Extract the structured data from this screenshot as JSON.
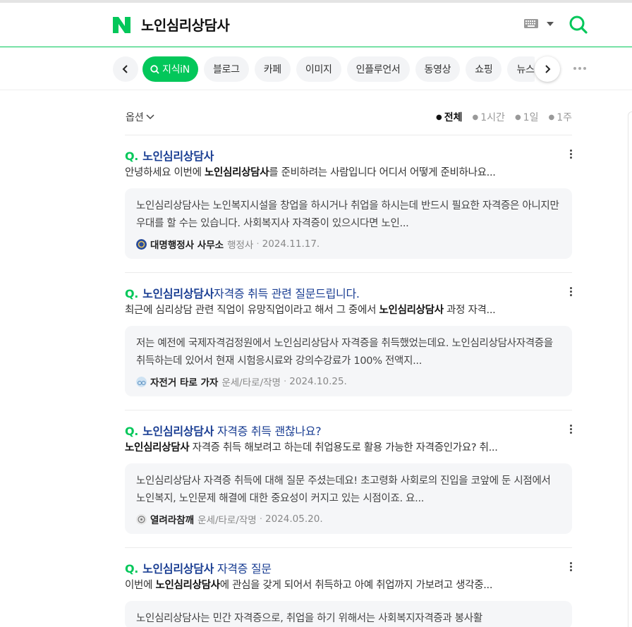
{
  "header": {
    "query": "노인심리상담사"
  },
  "tabs": {
    "items": [
      "지식iN",
      "블로그",
      "카페",
      "이미지",
      "인플루언서",
      "동영상",
      "쇼핑",
      "뉴스"
    ]
  },
  "options": {
    "label": "옵션",
    "periods": [
      "전체",
      "1시간",
      "1일",
      "1주"
    ]
  },
  "results": [
    {
      "title_bold": "노인심리상담사",
      "title_rest": "",
      "desc_pre": "안녕하세요 이번에 ",
      "desc_bold": "노인심리상담사",
      "desc_post": "를 준비하려는 사람입니다 어디서 어떻게 준비하나요...",
      "answer": "노인심리상담사는 노인복지시설을 창업을 하시거나 취업을 하시는데 반드시 필요한 자격증은 아니지만 우대를 할 수는 있습니다. 사회복지사 자격증이 있으시다면 노인...",
      "author": "대명행정사 사무소",
      "category": "행정사",
      "date": "2024.11.17."
    },
    {
      "title_bold": "노인심리상담사",
      "title_rest": "자격증 취득 관련 질문드립니다.",
      "desc_pre": "최근에 심리상담 관련 직업이 유망직업이라고 해서 그 중에서 ",
      "desc_bold": "노인심리상담사",
      "desc_post": " 과정 자격...",
      "answer": "저는 예전에 국제자격검정원에서 노인심리상담사 자격증을 취득했었는데요. 노인심리상담사자격증을 취득하는데 있어서 현재 시험응시료와 강의수강료가 100% 전액지...",
      "author": "자전거 타로 가자",
      "category": "운세/타로/작명",
      "date": "2024.10.25."
    },
    {
      "title_bold": "노인심리상담사",
      "title_rest": " 자격증 취득 괜찮나요?",
      "desc_pre": "",
      "desc_bold": "노인심리상담사",
      "desc_post": " 자격증 취득 해보려고 하는데 취업용도로 활용 가능한 자격증인가요? 취...",
      "answer": "노인심리상담사 자격증 취득에 대해 질문 주셨는데요! 초고령화 사회로의 진입을 코앞에 둔 시점에서 노인복지, 노인문제 해결에 대한 중요성이 커지고 있는 시점이죠. 요...",
      "author": "열려라참깨",
      "category": "운세/타로/작명",
      "date": "2024.05.20."
    },
    {
      "title_bold": "노인심리상담사",
      "title_rest": " 자격증 질문",
      "desc_pre": "이번에 ",
      "desc_bold": "노인심리상담사",
      "desc_post": "에 관심을 갖게 되어서 취득하고 아예 취업까지 가보려고 생각중...",
      "answer": "노인심리상담사는 민간 자격증으로, 취업을 하기 위해서는 사회복지자격증과 봉사활",
      "author": "",
      "category": "",
      "date": ""
    }
  ],
  "colors": {
    "brand": "#03c75a",
    "title": "#1a3e93"
  }
}
